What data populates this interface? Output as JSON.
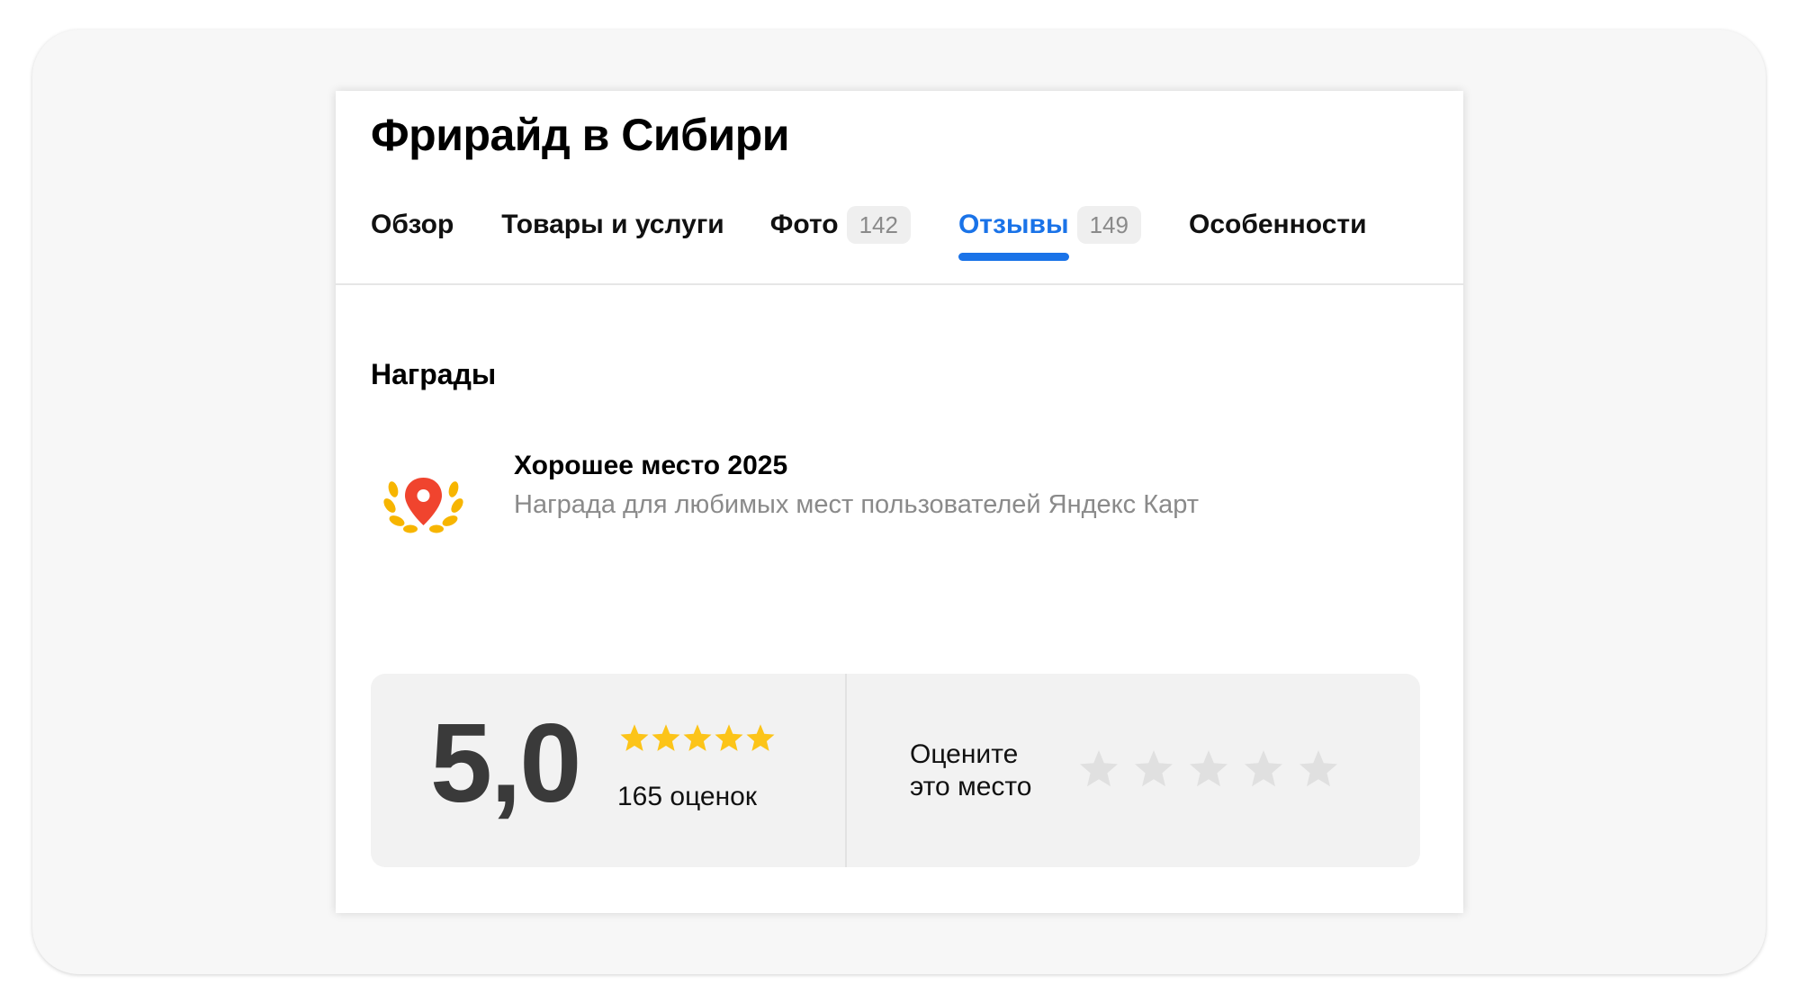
{
  "place": {
    "title": "Фрирайд в Сибири"
  },
  "tabs": [
    {
      "label": "Обзор",
      "count": null,
      "active": false
    },
    {
      "label": "Товары и услуги",
      "count": null,
      "active": false
    },
    {
      "label": "Фото",
      "count": "142",
      "active": false
    },
    {
      "label": "Отзывы",
      "count": "149",
      "active": true
    },
    {
      "label": "Особенности",
      "count": null,
      "active": false
    }
  ],
  "awards": {
    "section_title": "Награды",
    "items": [
      {
        "icon": "laurel-map-pin-icon",
        "title": "Хорошее место 2025",
        "description": "Награда для любимых мест пользователей Яндекс Карт"
      }
    ]
  },
  "rating": {
    "score": "5,0",
    "stars_filled": 5,
    "stars_total": 5,
    "count_label": "165 оценок",
    "rate_prompt_line1": "Оцените",
    "rate_prompt_line2": "это место",
    "user_rating": 0
  },
  "colors": {
    "accent": "#1a73e8",
    "star_filled": "#fcc419",
    "star_empty": "#e0e0e0",
    "pin": "#f0442e",
    "laurel": "#f7b500",
    "muted_text": "#8a8a8a"
  }
}
